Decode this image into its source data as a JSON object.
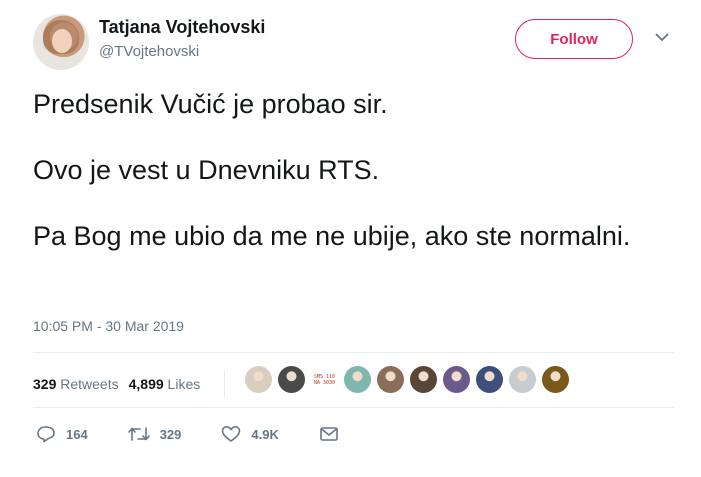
{
  "user": {
    "display_name": "Tatjana Vojtehovski",
    "handle": "@TVojtehovski"
  },
  "follow_label": "Follow",
  "tweet": {
    "paragraphs": [
      "Predsenik Vučić je probao sir.",
      "Ovo je vest u Dnevniku RTS.",
      "Pa Bog me ubio da me ne ubije, ako ste normalni."
    ],
    "timestamp": "10:05 PM - 30 Mar 2019"
  },
  "stats": {
    "retweets_count": "329",
    "retweets_label": "Retweets",
    "likes_count": "4,899",
    "likes_label": "Likes"
  },
  "liker_avatars": [
    {
      "color": "#d9cdbf"
    },
    {
      "color": "#4a4a4a"
    },
    {
      "text": "SMS 110 NA 3030",
      "color": "#ffffff"
    },
    {
      "color": "#7fb7b0"
    },
    {
      "color": "#8a6d5a"
    },
    {
      "color": "#5a4636"
    },
    {
      "color": "#6b5b8c"
    },
    {
      "color": "#3d4f7a"
    },
    {
      "color": "#c7ccd1"
    },
    {
      "color": "#7a5a1a"
    }
  ],
  "actions": {
    "replies": "164",
    "retweets": "329",
    "likes": "4.9K"
  },
  "colors": {
    "accent": "#e0245e",
    "muted": "#657786",
    "text": "#14171a"
  }
}
